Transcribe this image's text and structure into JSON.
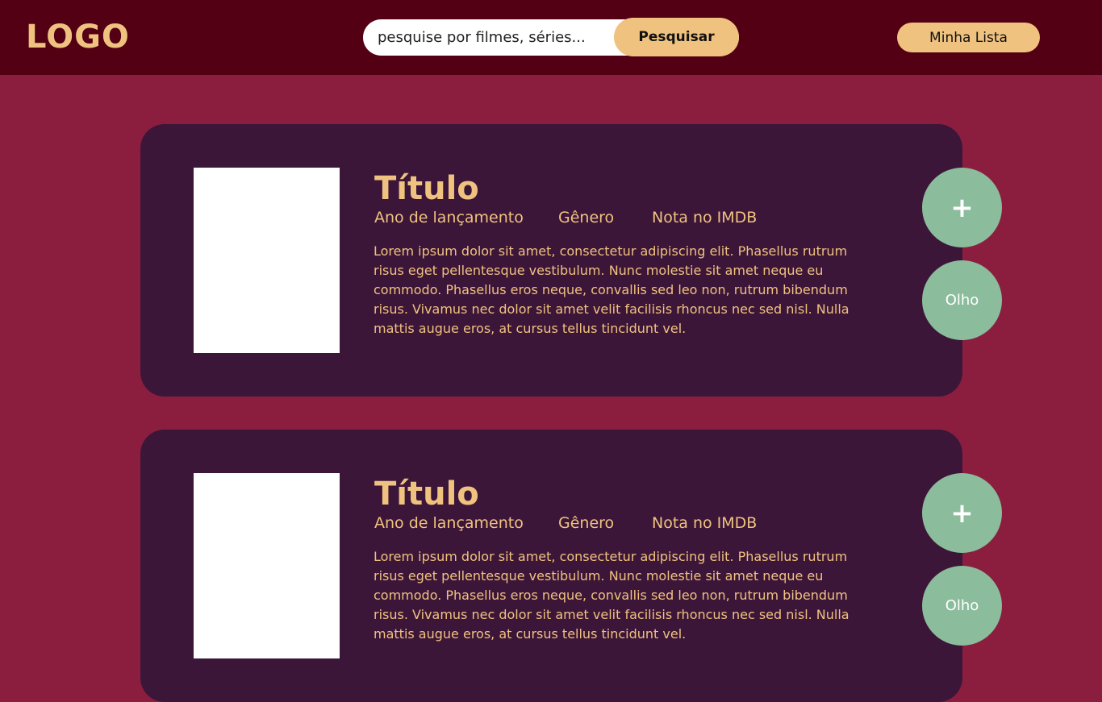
{
  "header": {
    "logo": "LOGO",
    "search_placeholder": "pesquise por filmes, séries...",
    "search_button": "Pesquisar",
    "my_list_button": "Minha Lista"
  },
  "results": [
    {
      "title": "Título",
      "year_label": "Ano de lançamento",
      "genre_label": "Gênero",
      "imdb_label": "Nota no IMDB",
      "description": "Lorem ipsum dolor sit amet, consectetur adipiscing elit. Phasellus rutrum risus eget pellentesque vestibulum. Nunc molestie sit amet neque eu commodo. Phasellus eros neque, convallis sed leo non, rutrum bibendum risus. Vivamus nec dolor sit amet velit facilisis rhoncus nec sed nisl. Nulla mattis augue eros, at cursus tellus tincidunt vel.",
      "add_button": "+",
      "eye_button": "Olho"
    },
    {
      "title": "Título",
      "year_label": "Ano de lançamento",
      "genre_label": "Gênero",
      "imdb_label": "Nota no IMDB",
      "description": "Lorem ipsum dolor sit amet, consectetur adipiscing elit. Phasellus rutrum risus eget pellentesque vestibulum. Nunc molestie sit amet neque eu commodo. Phasellus eros neque, convallis sed leo non, rutrum bibendum risus. Vivamus nec dolor sit amet velit facilisis rhoncus nec sed nisl. Nulla mattis augue eros, at cursus tellus tincidunt vel.",
      "add_button": "+",
      "eye_button": "Olho"
    }
  ],
  "colors": {
    "page_background": "#8b1e3f",
    "header_background": "#540014",
    "card_background": "#3c1639",
    "accent": "#f0c27f",
    "circle_button": "#8bbc9c"
  }
}
